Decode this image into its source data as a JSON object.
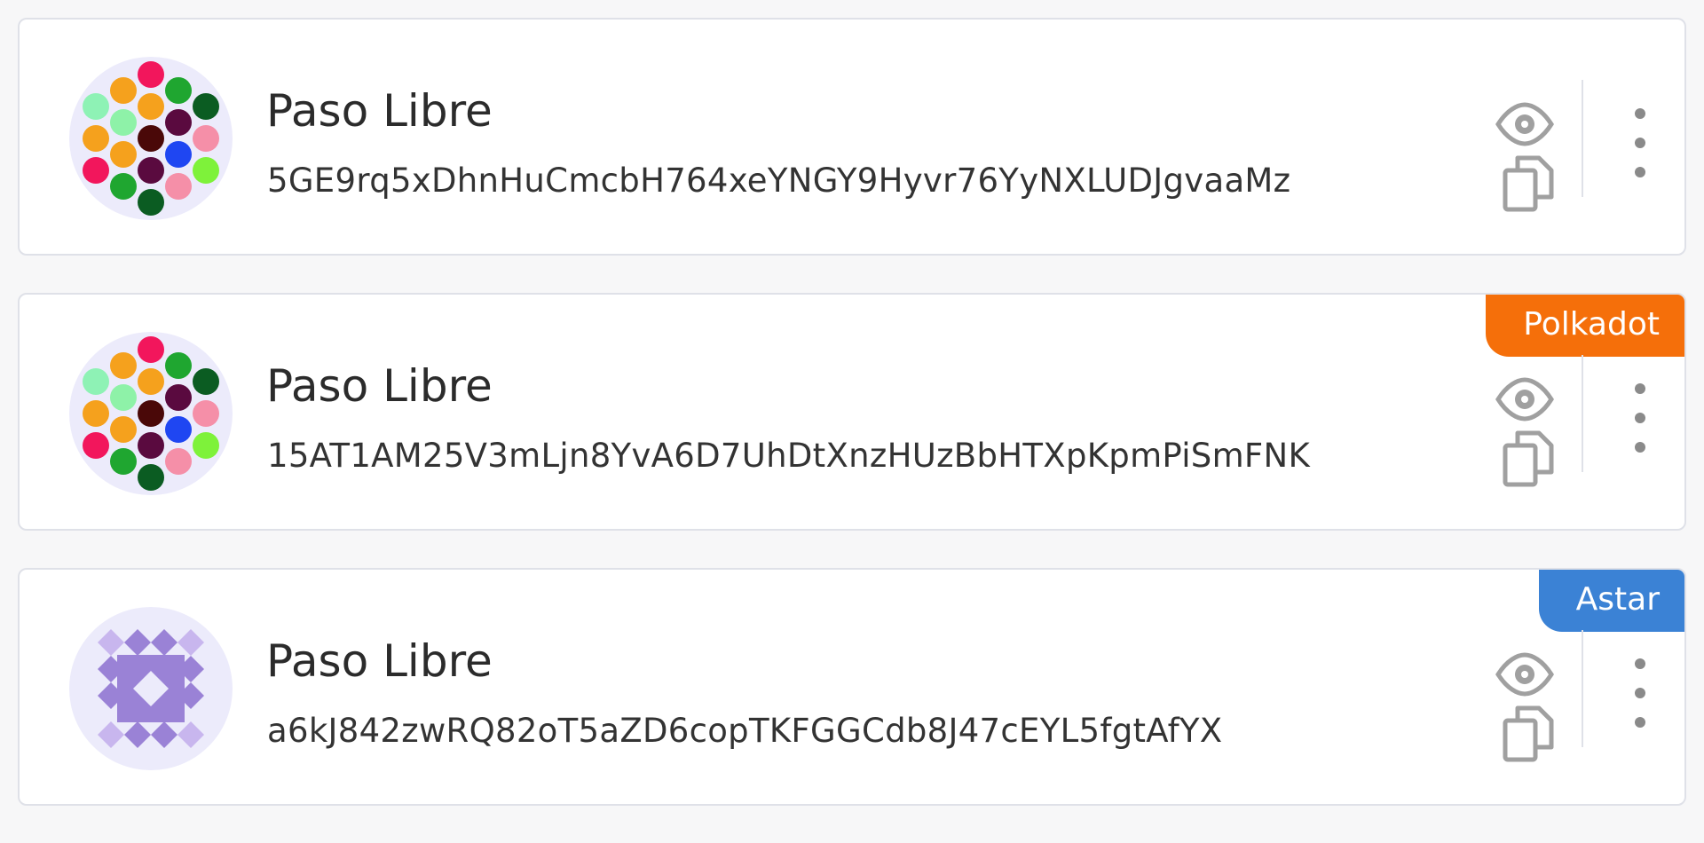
{
  "accounts": [
    {
      "name": "Paso Libre",
      "address": "5GE9rq5xDhnHuCmcbH764xeYNGY9Hyvr76YyNXLUDJgvaaMz",
      "avatar_style": "polkadot-identicon",
      "tag": null
    },
    {
      "name": "Paso Libre",
      "address": "15AT1AM25V3mLjn8YvA6D7UhDtXnzHUzBbHTXpKpmPiSmFNK",
      "avatar_style": "polkadot-identicon",
      "tag": {
        "label": "Polkadot",
        "color": "#f56f0a"
      }
    },
    {
      "name": "Paso Libre",
      "address": "a6kJ842zwRQ82oT5aZD6copTKFGGCdb8J47cEYL5fgtAfYX",
      "avatar_style": "square-identicon",
      "tag": {
        "label": "Astar",
        "color": "#3b82d5"
      }
    }
  ],
  "icons": {
    "view": "eye-icon",
    "copy": "copy-icon",
    "more": "more-vertical-icon"
  },
  "colors": {
    "card_border": "#dfe1e8",
    "icon_gray": "#a0a0a0",
    "avatar_bg": "#ecebfb"
  }
}
